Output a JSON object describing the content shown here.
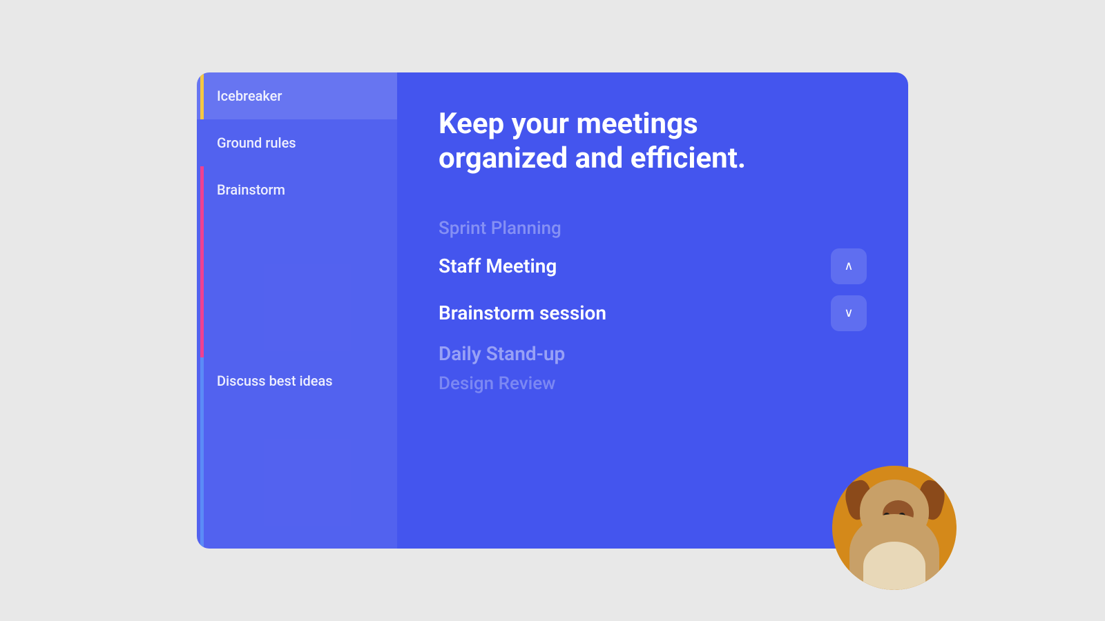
{
  "card": {
    "background_color": "#4455ee"
  },
  "sidebar": {
    "items": [
      {
        "id": "icebreaker",
        "label": "Icebreaker",
        "accent_color": "#f5c842",
        "active": true
      },
      {
        "id": "ground-rules",
        "label": "Ground rules",
        "accent_color": "transparent",
        "active": false
      },
      {
        "id": "brainstorm",
        "label": "Brainstorm",
        "accent_color": "#f04090",
        "active": false
      },
      {
        "id": "discuss-best-ideas",
        "label": "Discuss best ideas",
        "accent_color": "#6ab0ff",
        "active": false
      }
    ]
  },
  "content": {
    "headline": "Keep your meetings organized and efficient.",
    "meeting_list": {
      "faded_top": "Sprint Planning",
      "items": [
        {
          "id": "staff-meeting",
          "label": "Staff Meeting",
          "dimmed": false,
          "has_chevron_up": true
        },
        {
          "id": "brainstorm-session",
          "label": "Brainstorm session",
          "dimmed": false,
          "has_chevron_down": true
        },
        {
          "id": "daily-standup",
          "label": "Daily Stand-up",
          "dimmed": true
        },
        {
          "id": "design-review",
          "label": "Design Review",
          "dimmed": true,
          "extra_faded": true
        }
      ]
    }
  },
  "avatar": {
    "alt": "Dog avatar",
    "background_color": "#d4891a"
  },
  "chevrons": {
    "up": "∧",
    "down": "∨"
  }
}
